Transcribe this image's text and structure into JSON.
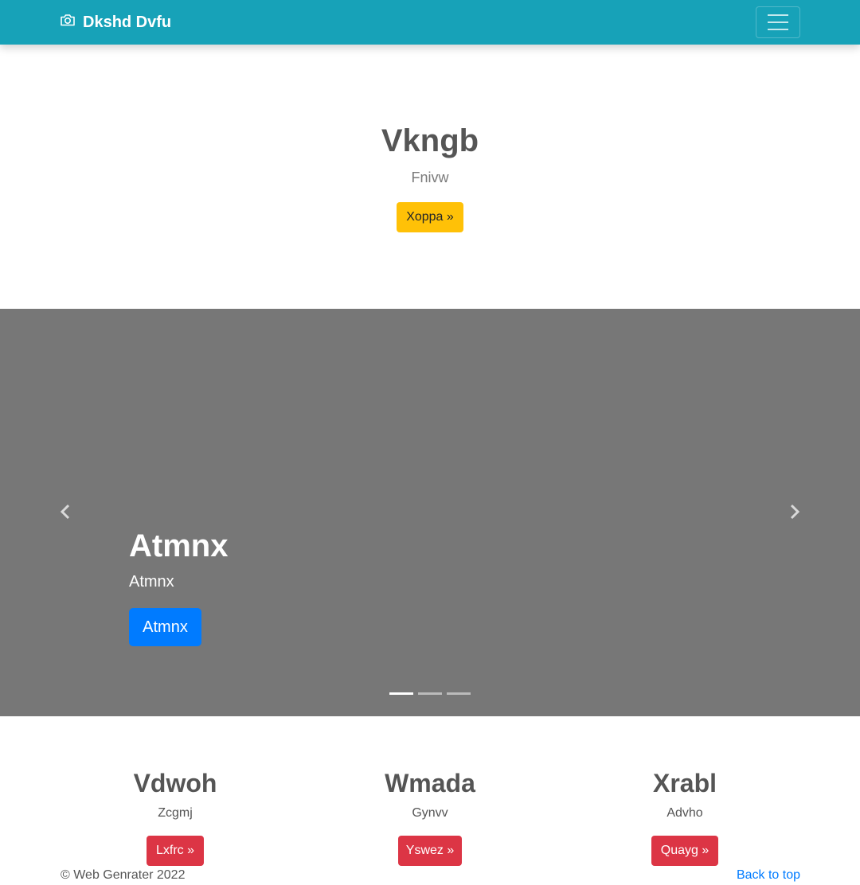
{
  "navbar": {
    "brand": "Dkshd Dvfu",
    "brand_icon": "camera-icon",
    "toggler_icon": "hamburger-icon",
    "bg_color": "#17a2b8"
  },
  "hero": {
    "title": "Vkngb",
    "subtitle": "Fnivw",
    "button_label": "Xoppa »"
  },
  "carousel": {
    "caption_title": "Atmnx",
    "caption_subtitle": "Atmnx",
    "button_label": "Atmnx",
    "prev_icon": "chevron-left-icon",
    "next_icon": "chevron-right-icon",
    "indicators": 3,
    "active_index": 0,
    "bg_color": "#777777"
  },
  "columns": [
    {
      "title": "Vdwoh",
      "text": "Zcgmj",
      "button_label": "Lxfrc »"
    },
    {
      "title": "Wmada",
      "text": "Gynvv",
      "button_label": "Yswez »"
    },
    {
      "title": "Xrabl",
      "text": "Advho",
      "button_label": "Quayg »"
    }
  ],
  "footer": {
    "copyright": "© Web Genrater 2022",
    "back_to_top": "Back to top"
  },
  "colors": {
    "warning": "#ffc107",
    "danger": "#dc3545",
    "primary": "#007bff",
    "link": "#007bff"
  }
}
